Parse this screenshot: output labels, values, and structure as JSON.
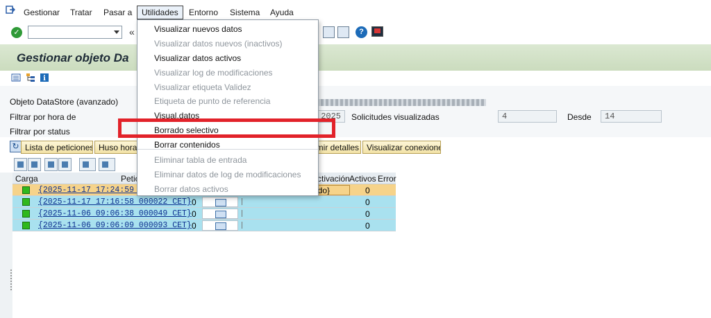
{
  "menubar": {
    "items": [
      "Gestionar",
      "Tratar",
      "Pasar a",
      "Utilidades",
      "Entorno",
      "Sistema",
      "Ayuda"
    ]
  },
  "toolbar": {
    "command_field_value": "",
    "collapse_glyph": "«"
  },
  "page": {
    "title": "Gestionar objeto Da"
  },
  "form": {
    "label_objeto": "Objeto DataStore (avanzado)",
    "label_filtrar_hora": "Filtrar por hora de",
    "label_filtrar_status": "Filtrar por status",
    "field_year_partial": "2025",
    "label_solicitudes": "Solicitudes visualizadas",
    "solicitudes_value": "4",
    "label_desde": "Desde",
    "desde_value": "14"
  },
  "buttons": {
    "lista_peticiones": "Lista de peticiones ◂",
    "huso_horario": "Huso horari",
    "imir_detalles": "imir detalles",
    "visualizar_conexiones": "Visualizar conexiones"
  },
  "table": {
    "headers": {
      "carga": "Carga",
      "petic": "Petic",
      "activacion": "ctivación",
      "activos": "Activos",
      "error": "Error"
    },
    "rows": [
      {
        "request": "{2025-11-17 17:24:59 000",
        "count": "",
        "activation": "ctivado}",
        "activos": "0"
      },
      {
        "request": "{2025-11-17 17:16:58 000022 CET}",
        "count": "0",
        "activation": "",
        "activos": "0"
      },
      {
        "request": "{2025-11-06 09:06:38 000049 CET}",
        "count": "0",
        "activation": "",
        "activos": "0"
      },
      {
        "request": "{2025-11-06 09:06:09 000093 CET}",
        "count": "0",
        "activation": "",
        "activos": "0"
      }
    ]
  },
  "dropdown": {
    "items": [
      {
        "label": "Visualizar nuevos datos",
        "enabled": true
      },
      {
        "label": "Visualizar datos nuevos (inactivos)",
        "enabled": false
      },
      {
        "label": "Visualizar datos activos",
        "enabled": true
      },
      {
        "label": "Visualizar log de modificaciones",
        "enabled": false
      },
      {
        "label": "Visualizar etiqueta Validez",
        "enabled": false
      },
      {
        "label": "Etiqueta de punto de referencia",
        "enabled": false
      },
      {
        "label": "Visual.datos",
        "enabled": true
      },
      {
        "label": "Borrado selectivo",
        "enabled": true
      },
      {
        "label": "Borrar contenidos",
        "enabled": true
      },
      {
        "label": "Eliminar tabla de entrada",
        "enabled": false
      },
      {
        "label": "Eliminar datos de log de modificaciones",
        "enabled": false
      },
      {
        "label": "Borrar datos activos",
        "enabled": false
      }
    ]
  },
  "colors": {
    "highlight": "#e2222a",
    "title_bar": "#cbdcbe",
    "row_selected": "#f6d38a",
    "row_normal": "#a9e1ef",
    "button_bg": "#f2e2a5"
  }
}
